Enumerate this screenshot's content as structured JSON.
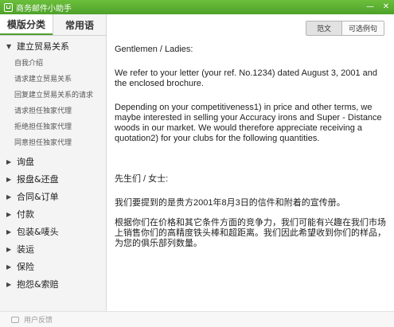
{
  "window": {
    "title": "商务邮件小助手",
    "minimize_glyph": "—",
    "close_glyph": "✕"
  },
  "sidebar": {
    "tabs": [
      {
        "label": "模版分类",
        "active": true
      },
      {
        "label": "常用语",
        "active": false
      }
    ],
    "groups": [
      {
        "label": "建立贸易关系",
        "expanded": true,
        "items": [
          "自我介绍",
          "请求建立贸易关系",
          "回复建立贸易关系的请求",
          "请求担任独家代理",
          "拒绝担任独家代理",
          "同意担任独家代理"
        ]
      },
      {
        "label": "询盘",
        "expanded": false
      },
      {
        "label": "报盘&还盘",
        "expanded": false
      },
      {
        "label": "合同&订单",
        "expanded": false
      },
      {
        "label": "付款",
        "expanded": false
      },
      {
        "label": "包装&唛头",
        "expanded": false
      },
      {
        "label": "装运",
        "expanded": false
      },
      {
        "label": "保险",
        "expanded": false
      },
      {
        "label": "抱怨&索赔",
        "expanded": false
      }
    ]
  },
  "content": {
    "toggle": {
      "sample_label": "范文",
      "phrase_label": "可选例句",
      "active": "sample"
    },
    "letter": {
      "salutation_en": "Gentlemen / Ladies:",
      "para1_en": "We refer to your letter (your ref. No.1234) dated August 3, 2001 and the enclosed brochure.",
      "para2_en": "Depending on your competitiveness1) in price and other terms, we maybe interested in selling your Accuracy irons and Super - Distance woods in our market. We would therefore appreciate receiving a quotation2) for your clubs for the following quantities.",
      "salutation_cn": "先生们 / 女士:",
      "para1_cn": "我们要提到的是贵方2001年8月3日的信件和附着的宣传册。",
      "para2_cn": "根据你们在价格和其它条件方面的竞争力，我们可能有兴趣在我们市场上销售你们的高精度铁头棒和超距离。我们因此希望收到你们的样品，为您的俱乐部列数量。"
    }
  },
  "statusbar": {
    "feedback_label": "用户反馈"
  },
  "colors": {
    "titlebar": "#4da12a",
    "accent": "#4da12a",
    "sidebar_bg": "#f4f4f4"
  }
}
